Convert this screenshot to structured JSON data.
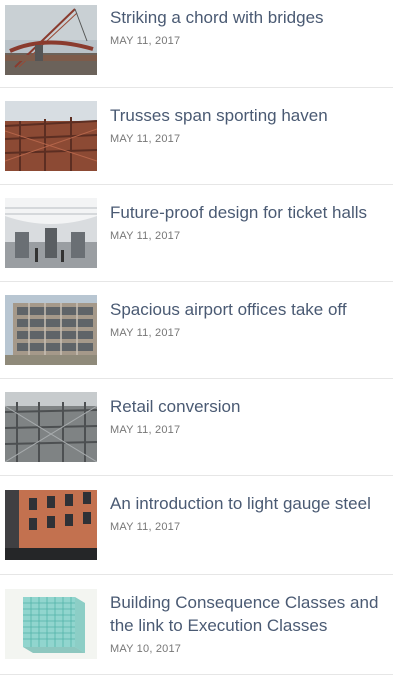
{
  "articles": [
    {
      "title": "Striking a chord with bridges",
      "date": "MAY 11, 2017",
      "image": "crane-bridge-photo"
    },
    {
      "title": "Trusses span sporting haven",
      "date": "MAY 11, 2017",
      "image": "steel-trusses-photo"
    },
    {
      "title": "Future-proof design for ticket halls",
      "date": "MAY 11, 2017",
      "image": "ticket-hall-photo"
    },
    {
      "title": "Spacious airport offices take off",
      "date": "MAY 11, 2017",
      "image": "airport-office-photo"
    },
    {
      "title": "Retail conversion",
      "date": "MAY 11, 2017",
      "image": "retail-steel-frame-photo"
    },
    {
      "title": "An introduction to light gauge steel",
      "date": "MAY 11, 2017",
      "image": "light-gauge-building-photo"
    },
    {
      "title": "Building Consequence Classes and the link to Execution Classes",
      "date": "MAY 10, 2017",
      "image": "3d-grid-model-image"
    }
  ]
}
